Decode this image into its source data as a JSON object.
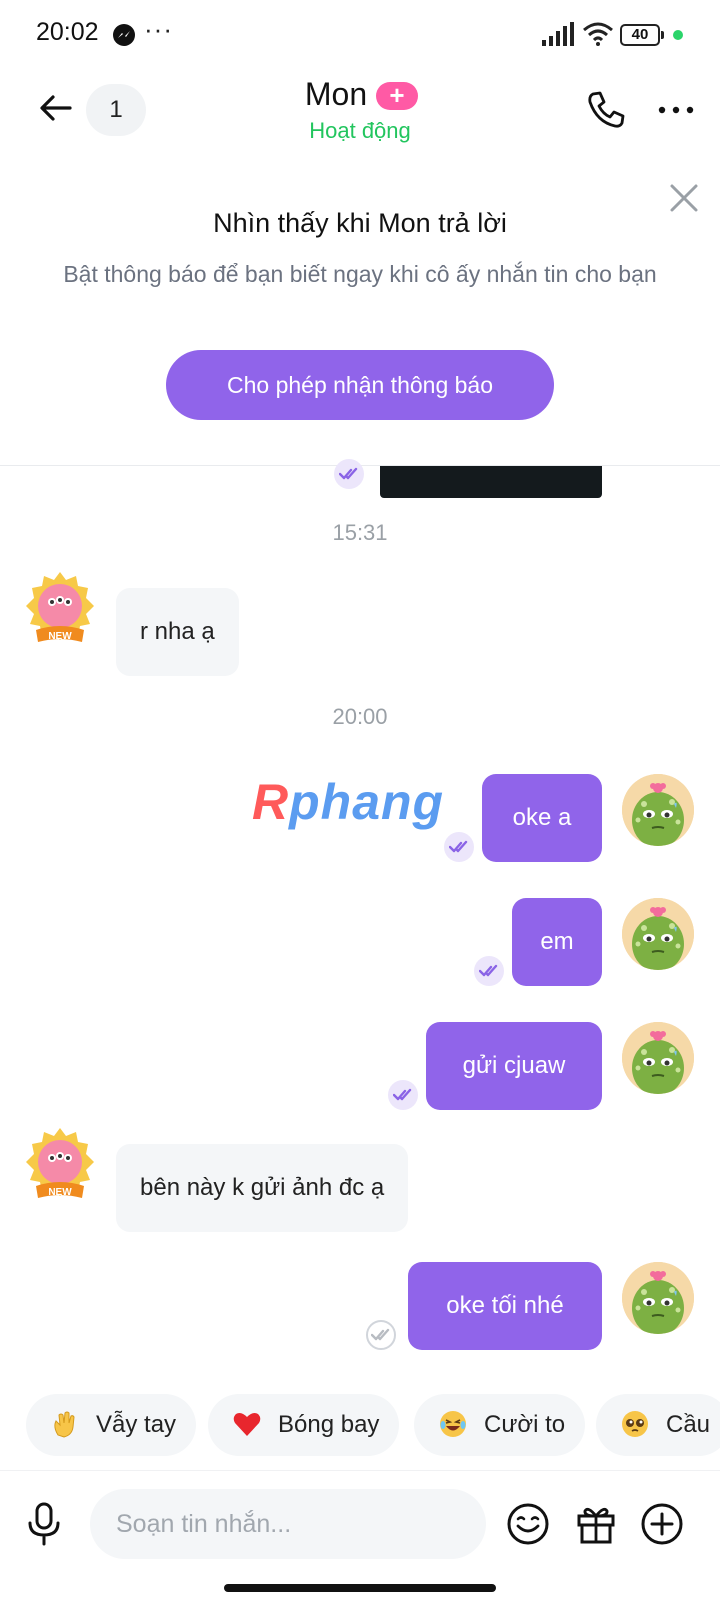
{
  "status_bar": {
    "time": "20:02",
    "dots": "···",
    "battery": "40"
  },
  "header": {
    "unread_count": "1",
    "contact_name": "Mon",
    "plus_badge": "+",
    "status": "Hoạt động",
    "status_color": "#22c55e"
  },
  "notification": {
    "title": "Nhìn thấy khi Mon trả lời",
    "description": "Bật thông báo để bạn biết ngay khi cô ấy nhắn tin cho bạn",
    "button_label": "Cho phép nhận thông báo",
    "accent": "#9064ea"
  },
  "chat": {
    "timestamps": [
      "15:31",
      "20:00"
    ],
    "watermark": "Rphang",
    "messages": [
      {
        "direction": "in",
        "text": "r nha ạ"
      },
      {
        "direction": "out",
        "text": "oke a",
        "status": "seen"
      },
      {
        "direction": "out",
        "text": "em",
        "status": "seen"
      },
      {
        "direction": "out",
        "text": "gửi cjuaw",
        "status": "seen"
      },
      {
        "direction": "in",
        "text": "bên này k gửi ảnh đc ạ"
      },
      {
        "direction": "out",
        "text": "oke tối nhé",
        "status": "sent"
      }
    ],
    "incoming_avatar_badge": "NEW"
  },
  "quick_reactions": [
    {
      "icon": "waving-hand-icon",
      "label": "Vẫy tay"
    },
    {
      "icon": "heart-icon",
      "label": "Bóng bay"
    },
    {
      "icon": "laughing-face-icon",
      "label": "Cười to"
    },
    {
      "icon": "pleading-face-icon",
      "label": "Cầu"
    }
  ],
  "composer": {
    "placeholder": "Soạn tin nhắn..."
  }
}
